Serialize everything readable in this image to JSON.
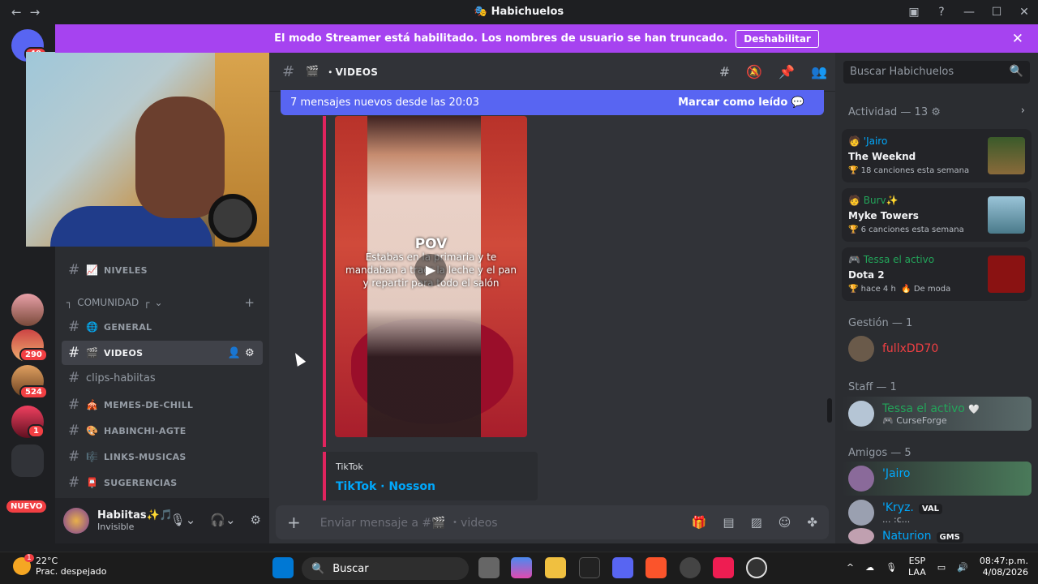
{
  "titlebar": {
    "title": "Habichuelos"
  },
  "streamer_banner": {
    "text": "El modo Streamer está habilitado. Los nombres de usuario se han truncado.",
    "button": "Deshabilitar"
  },
  "guilds": {
    "badges": [
      "40",
      "290",
      "524",
      "1"
    ],
    "new_label": "NUEVO"
  },
  "channels": {
    "partial_top": {
      "name": "NIVELES",
      "emoji": "📈"
    },
    "category": "COMUNIDAD",
    "items": [
      {
        "name": "GENERAL",
        "emoji": "🌐"
      },
      {
        "name": "VIDEOS",
        "emoji": "🎬"
      },
      {
        "name": "clips-habiitas",
        "emoji": ""
      },
      {
        "name": "MEMES-DE-CHILL",
        "emoji": "🎪"
      },
      {
        "name": "HABINCHI-AGTE",
        "emoji": "🎨"
      },
      {
        "name": "LINKS-MUSICAS",
        "emoji": "🎼"
      },
      {
        "name": "SUGERENCIAS",
        "emoji": "📮"
      }
    ]
  },
  "user": {
    "name": "Habiitas✨🎵",
    "status": "Invisible"
  },
  "header": {
    "channel": "VIDEOS"
  },
  "new_messages": {
    "text": "7 mensajes nuevos desde las 20:03",
    "mark_read": "Marcar como leído"
  },
  "video": {
    "pov": "POV",
    "caption": "Estabas en la primaria y te mandaban a traer la leche y el pan y repartir para todo el salón"
  },
  "embed": {
    "provider": "TikTok",
    "title": "TikTok · Nosson"
  },
  "composer": {
    "placeholder": "Enviar mensaje a #🎬 ・videos"
  },
  "members": {
    "search_placeholder": "Buscar Habichuelos",
    "activity_header": "Actividad — 13",
    "activities": [
      {
        "user": "'Jairo",
        "user_color": "#00a8fc",
        "what": "The Weeknd",
        "meta": "18 canciones esta semana"
      },
      {
        "user": "Burv✨",
        "user_color": "#23a55a",
        "what": "Myke Towers",
        "meta": "6 canciones esta semana"
      },
      {
        "user": "Tessa el activo",
        "user_color": "#23a55a",
        "what": "Dota 2",
        "meta": "hace 4 h",
        "meta2": "De moda"
      }
    ],
    "groups": [
      {
        "header": "Gestión — 1",
        "members": [
          {
            "name": "fullxDD70",
            "color": "#f23f43",
            "sub": ""
          }
        ]
      },
      {
        "header": "Staff — 1",
        "members": [
          {
            "name": "Tessa el activo",
            "color": "#23a55a",
            "sub": "CurseForge"
          }
        ]
      },
      {
        "header": "Amigos — 5",
        "members": [
          {
            "name": "'Jairo",
            "color": "#00a8fc",
            "sub": ""
          },
          {
            "name": "'Kryz.",
            "color": "#00a8fc",
            "sub": "... :c...",
            "tag": "VAL"
          },
          {
            "name": "Naturion",
            "color": "#00a8fc",
            "sub": "",
            "tag": "GMS"
          }
        ]
      }
    ]
  },
  "taskbar": {
    "weather_temp": "22°C",
    "weather_desc": "Prac. despejado",
    "weather_badge": "1",
    "search": "Buscar",
    "lang1": "ESP",
    "lang2": "LAA",
    "time": "08:47:p.m.",
    "date": "4/08/2026"
  }
}
